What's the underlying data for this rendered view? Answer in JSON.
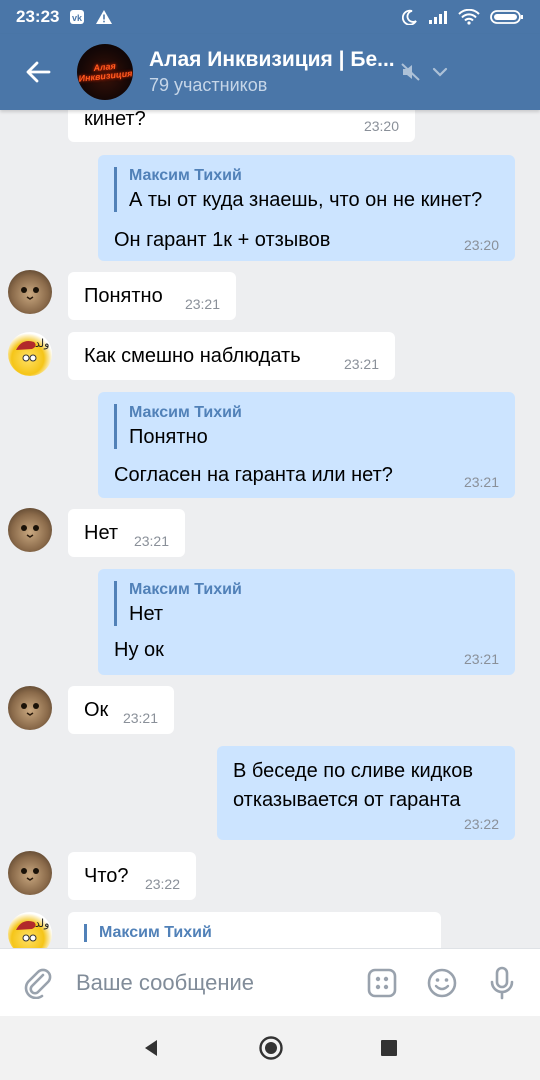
{
  "status_bar": {
    "time": "23:23"
  },
  "header": {
    "title": "Алая Инквизиция | Бе...",
    "subtitle": "79 участников",
    "avatar_text": "Алая\nИнквизиция"
  },
  "messages": [
    {
      "text": "кинет?",
      "time": "23:20"
    },
    {
      "quote_author": "Максим Тихий",
      "quote_text": "А ты от куда знаешь, что он не кинет?",
      "text": "Он гарант 1к + отзывов",
      "time": "23:20"
    },
    {
      "text": "Понятно",
      "time": "23:21"
    },
    {
      "text": "Как смешно наблюдать",
      "time": "23:21"
    },
    {
      "quote_author": "Максим Тихий",
      "quote_text": "Понятно",
      "text": "Согласен на гаранта или нет?",
      "time": "23:21"
    },
    {
      "text": "Нет",
      "time": "23:21"
    },
    {
      "quote_author": "Максим Тихий",
      "quote_text": "Нет",
      "text": "Ну ок",
      "time": "23:21"
    },
    {
      "text": "Ок",
      "time": "23:21"
    },
    {
      "line1": "В беседе по сливе кидков",
      "line2": "отказывается от гаранта",
      "time": "23:22"
    },
    {
      "text": "Что?",
      "time": "23:22"
    },
    {
      "quote_author": "Максим Тихий"
    }
  ],
  "input": {
    "placeholder": "Ваше сообщение"
  },
  "colors": {
    "header": "#4a76a8",
    "outgoing_bubble": "#cce4ff",
    "incoming_bubble": "#ffffff",
    "background": "#edeef0",
    "accent": "#5181b8"
  },
  "icons": [
    "back-arrow-icon",
    "muted-speaker-icon",
    "chevron-down-icon",
    "paperclip-icon",
    "keyboard-grid-icon",
    "emoji-icon",
    "microphone-icon"
  ]
}
